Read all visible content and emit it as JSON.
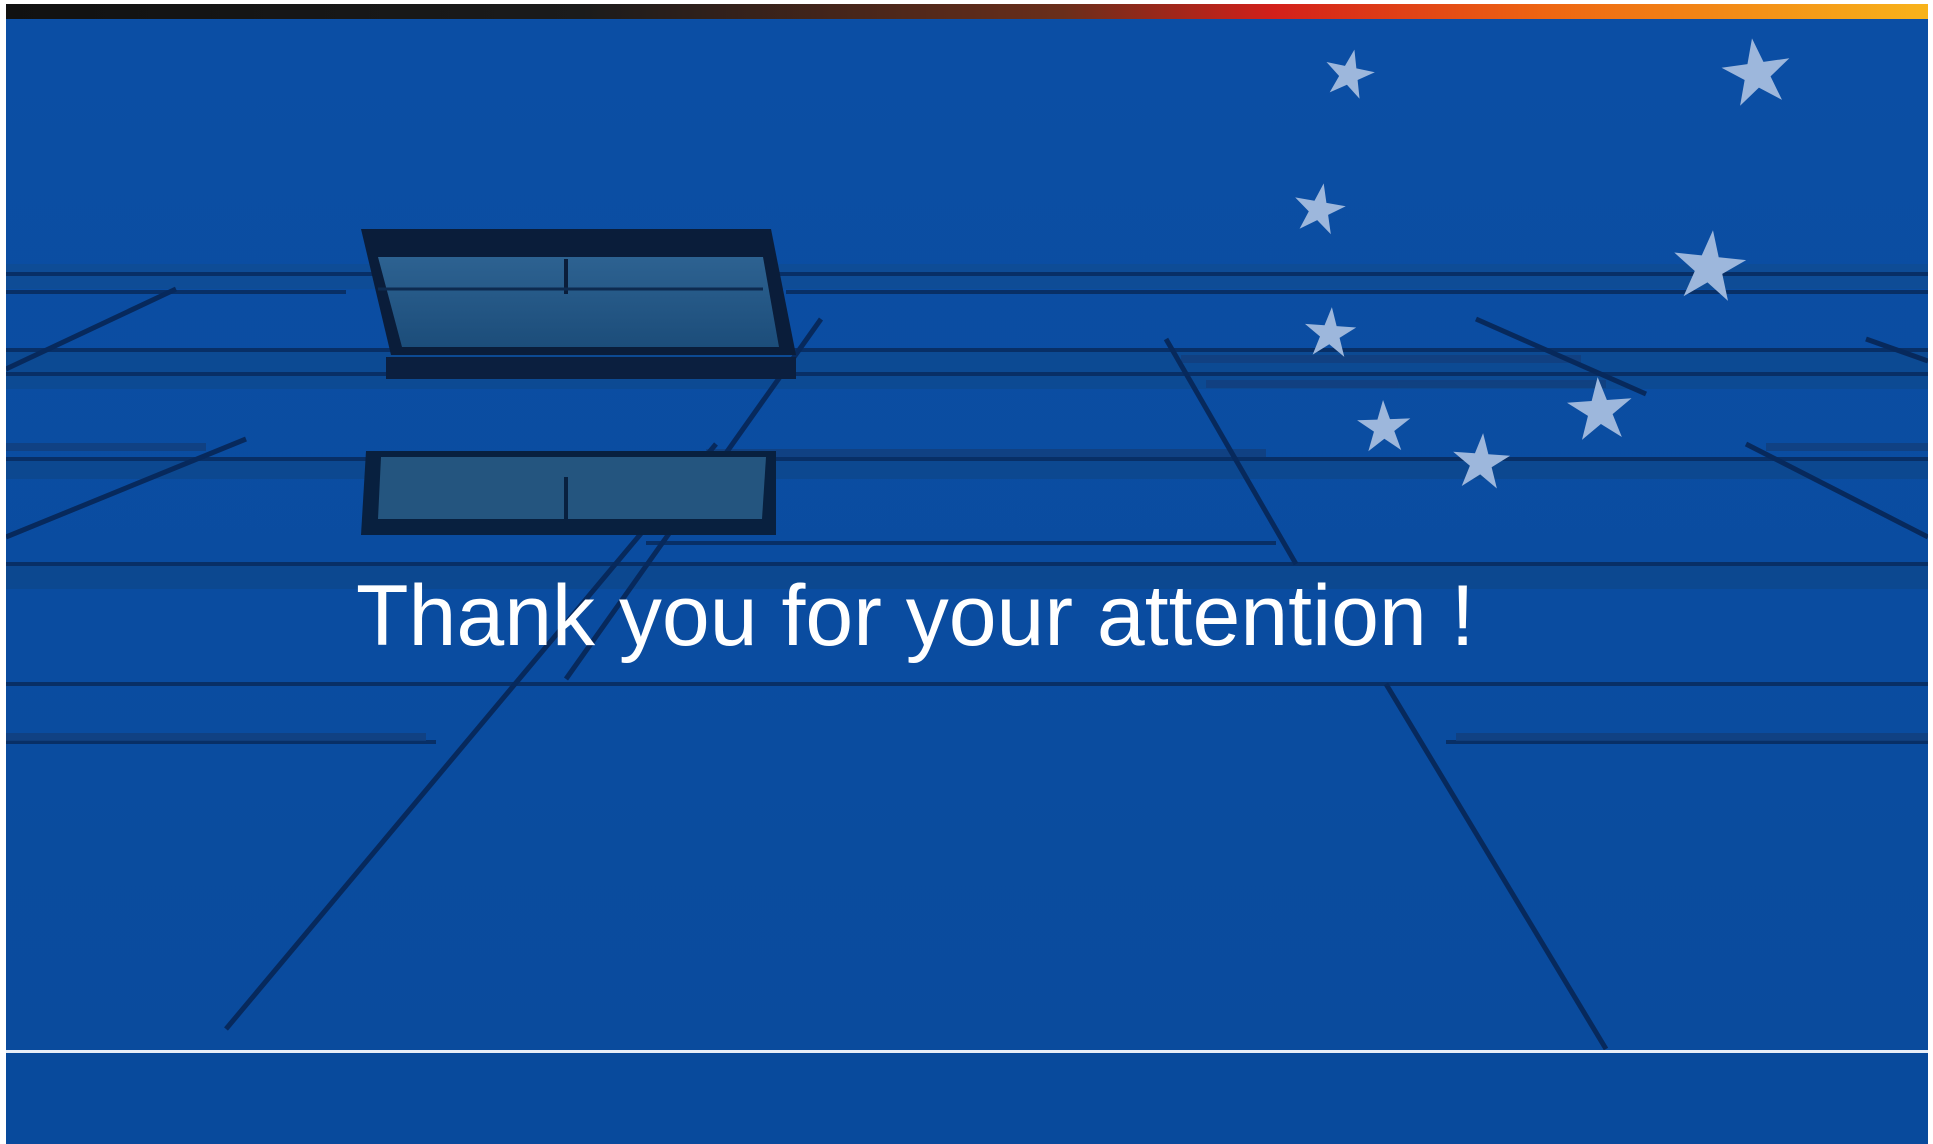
{
  "slide": {
    "headline": "Thank you for your attention !"
  },
  "colors": {
    "background": "#0a4d9e",
    "headline": "#ffffff",
    "stars": "#9db7dc",
    "footer_band": "#084a9c",
    "divider": "#e8eef8"
  },
  "decor": {
    "background_image": "blue-glass-facade-with-open-window",
    "stars": [
      "star-icon",
      "star-icon",
      "star-icon",
      "star-icon",
      "star-icon",
      "star-icon",
      "star-icon",
      "star-icon",
      "star-icon"
    ]
  }
}
